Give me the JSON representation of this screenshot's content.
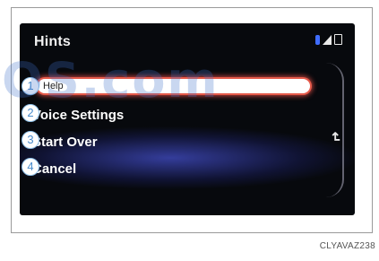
{
  "screen": {
    "title": "Hints",
    "menu": [
      {
        "label": "Help",
        "selected": true
      },
      {
        "label": "Voice Settings",
        "selected": false
      },
      {
        "label": "Start Over",
        "selected": false
      },
      {
        "label": "Cancel",
        "selected": false
      }
    ]
  },
  "callouts": [
    "1",
    "2",
    "3",
    "4"
  ],
  "watermark": "OS.com",
  "image_code": "CLYAVAZ238",
  "colors": {
    "highlight": "#e55a4a",
    "accent_blue": "#3f6dff",
    "callout": "#4a8ccc"
  },
  "icons": [
    "bluetooth-icon",
    "signal-icon",
    "battery-icon",
    "back-icon"
  ]
}
